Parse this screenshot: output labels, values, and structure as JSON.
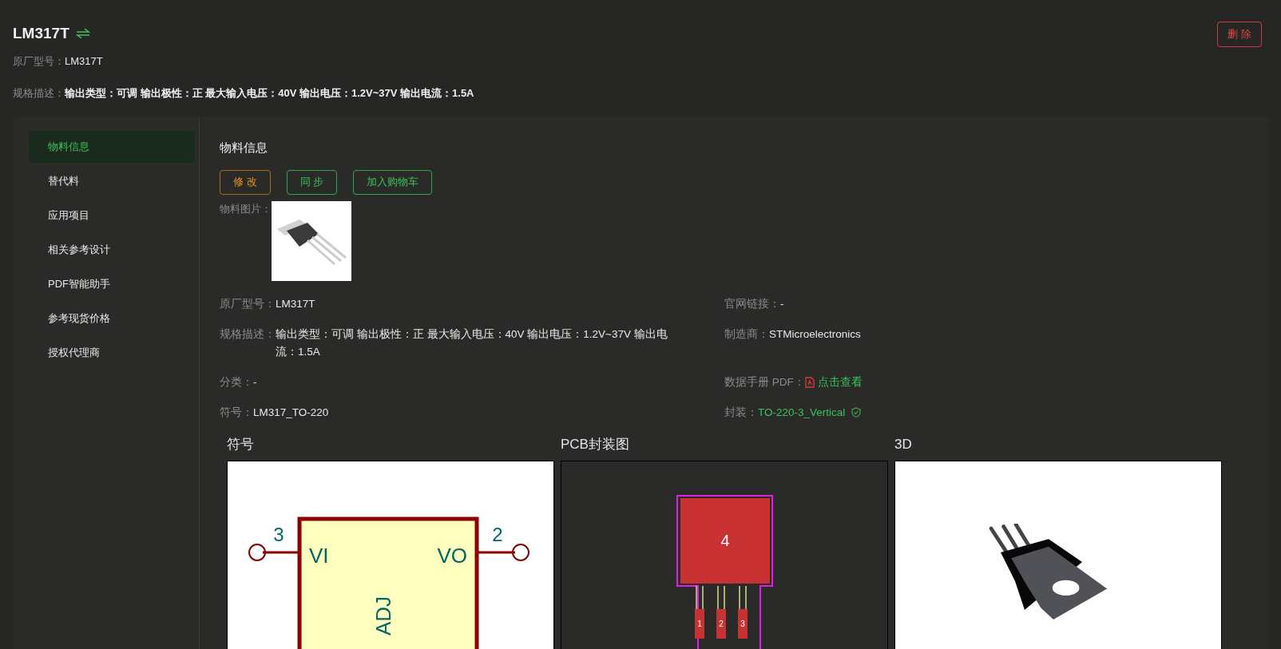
{
  "header": {
    "title": "LM317T",
    "delete_button": "删 除",
    "fields": [
      {
        "label": "原厂型号：",
        "value": "LM317T"
      },
      {
        "label": "规格描述：",
        "value": "输出类型：可调 输出极性：正 最大输入电压：40V 输出电压：1.2V~37V 输出电流：1.5A"
      }
    ]
  },
  "sidebar": {
    "items": [
      {
        "label": "物料信息",
        "selected": true
      },
      {
        "label": "替代料",
        "selected": false
      },
      {
        "label": "应用项目",
        "selected": false
      },
      {
        "label": "相关参考设计",
        "selected": false
      },
      {
        "label": "PDF智能助手",
        "selected": false
      },
      {
        "label": "参考现货价格",
        "selected": false
      },
      {
        "label": "授权代理商",
        "selected": false
      }
    ]
  },
  "section": {
    "title": "物料信息",
    "buttons": [
      {
        "label": "修 改",
        "kind": "edit"
      },
      {
        "label": "同 步",
        "kind": "sync"
      },
      {
        "label": "加入购物车",
        "kind": "cart"
      }
    ],
    "image_label": "物料图片：",
    "fields": [
      {
        "label": "原厂型号：",
        "value": "LM317T",
        "kind": "text"
      },
      {
        "label": "官网链接：",
        "value": "-",
        "kind": "text"
      },
      {
        "label": "规格描述：",
        "value": "输出类型：可调 输出极性：正 最大输入电压：40V 输出电压：1.2V~37V 输出电流：1.5A",
        "kind": "text"
      },
      {
        "label": "制造商：",
        "value": "STMicroelectronics",
        "kind": "text"
      },
      {
        "label": "分类：",
        "value": "-",
        "kind": "text"
      },
      {
        "label": "数据手册 PDF：",
        "value": "点击查看",
        "kind": "pdf_link"
      },
      {
        "label": "符号：",
        "value": "LM317_TO-220",
        "kind": "text"
      },
      {
        "label": "封装：",
        "value": "TO-220-3_Vertical",
        "kind": "package_link"
      }
    ]
  },
  "previews": [
    {
      "title": "符号",
      "kind": "symbol",
      "labels": [
        "3",
        "VI",
        "VO",
        "2",
        "ADJ"
      ]
    },
    {
      "title": "PCB封装图",
      "kind": "pcb",
      "labels": [
        "4",
        "1",
        "2",
        "3"
      ]
    },
    {
      "title": "3D",
      "kind": "model"
    }
  ]
}
